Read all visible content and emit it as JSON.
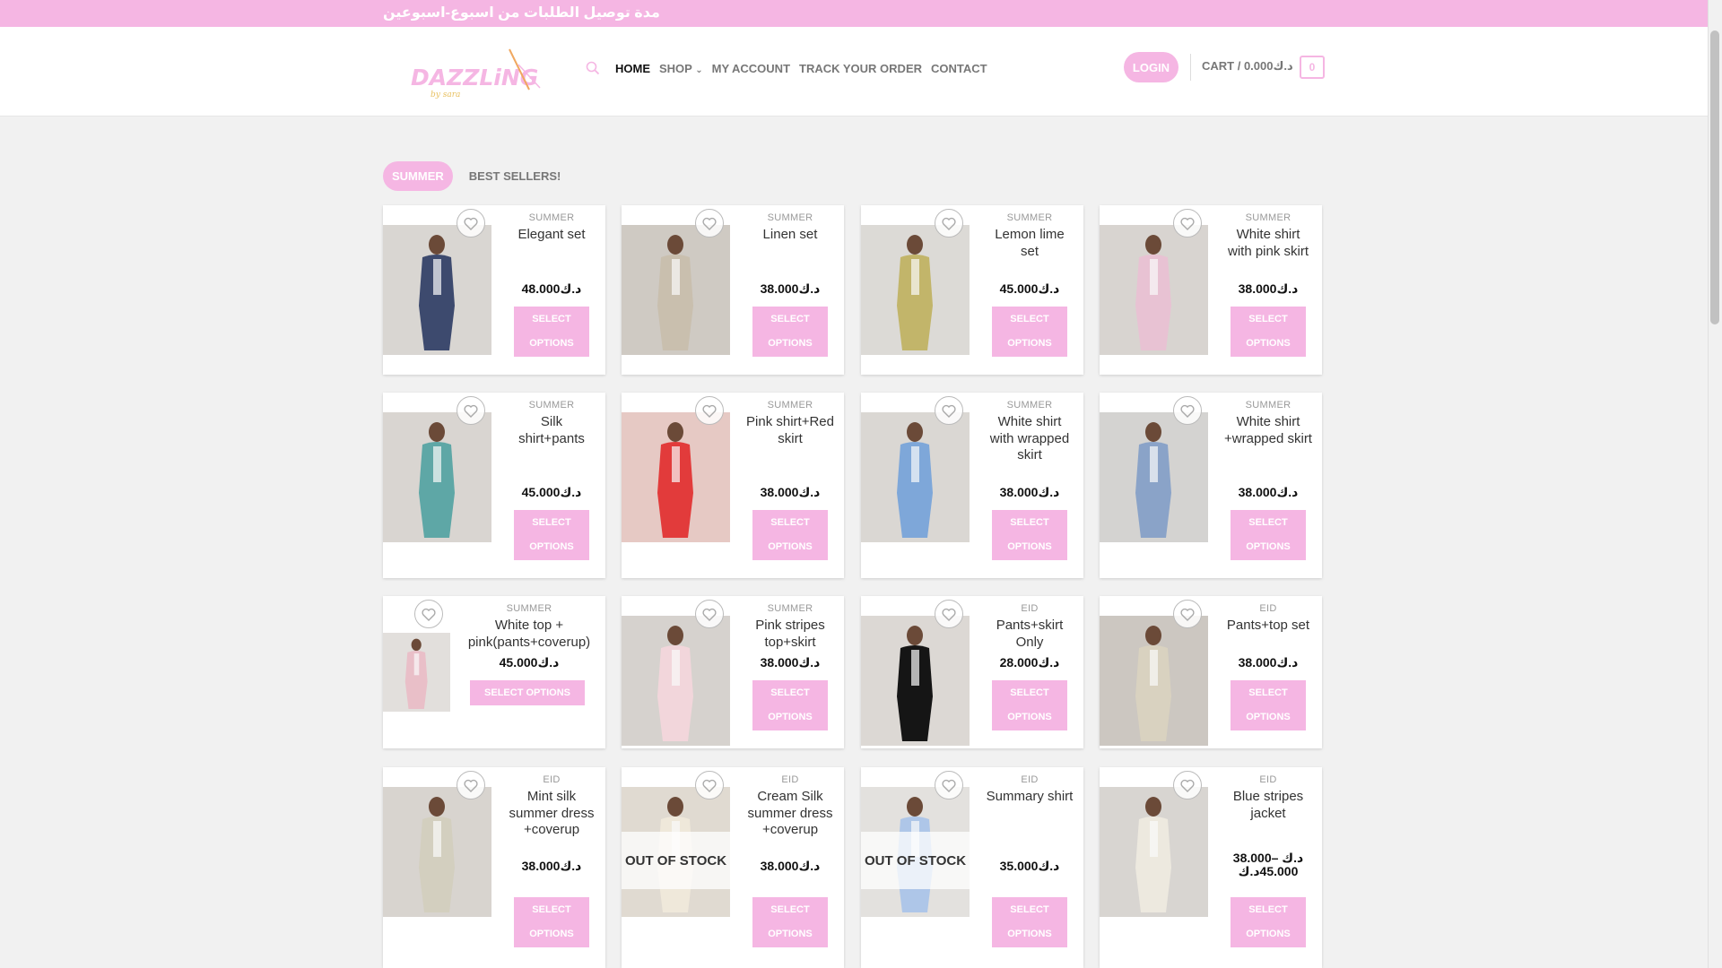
{
  "topbar": {
    "text": "مدة توصيل الطلبات من اسبوع-اسبوعين"
  },
  "header": {
    "logo_text": "DAZZLiNG",
    "logo_sub": "by sara",
    "nav": [
      {
        "label": "HOME",
        "active": true
      },
      {
        "label": "SHOP",
        "active": false
      },
      {
        "label": "MY ACCOUNT",
        "active": false
      },
      {
        "label": "TRACK YOUR ORDER",
        "active": false
      },
      {
        "label": "CONTACT",
        "active": false
      }
    ],
    "login_label": "LOGIN",
    "cart_label": "CART / 0.000د.ك",
    "cart_count": "0"
  },
  "tabs": [
    {
      "label": "SUMMER",
      "active": true
    },
    {
      "label": "BEST SELLERS!",
      "active": false
    }
  ],
  "products": [
    {
      "category": "SUMMER",
      "title": "Elegant set",
      "price": "48.000د.ك",
      "button": "SELECT OPTIONS",
      "out_of_stock": false
    },
    {
      "category": "SUMMER",
      "title": "Linen set",
      "price": "38.000د.ك",
      "button": "SELECT OPTIONS",
      "out_of_stock": false
    },
    {
      "category": "SUMMER",
      "title": "Lemon lime set",
      "price": "45.000د.ك",
      "button": "SELECT OPTIONS",
      "out_of_stock": false
    },
    {
      "category": "SUMMER",
      "title": "White shirt with pink skirt",
      "price": "38.000د.ك",
      "button": "SELECT OPTIONS",
      "out_of_stock": false
    },
    {
      "category": "SUMMER",
      "title": "Silk shirt+pants",
      "price": "45.000د.ك",
      "button": "SELECT OPTIONS",
      "out_of_stock": false
    },
    {
      "category": "SUMMER",
      "title": "Pink shirt+Red skirt",
      "price": "38.000د.ك",
      "button": "SELECT OPTIONS",
      "out_of_stock": false
    },
    {
      "category": "SUMMER",
      "title": "White shirt with wrapped skirt",
      "price": "38.000د.ك",
      "button": "SELECT OPTIONS",
      "out_of_stock": false
    },
    {
      "category": "SUMMER",
      "title": "White shirt +wrapped skirt",
      "price": "38.000د.ك",
      "button": "SELECT OPTIONS",
      "out_of_stock": false
    },
    {
      "category": "SUMMER",
      "title": "White top + pink(pants+coverup)",
      "price": "45.000د.ك",
      "button": "SELECT OPTIONS",
      "out_of_stock": false
    },
    {
      "category": "SUMMER",
      "title": "Pink stripes top+skirt",
      "price": "38.000د.ك",
      "button": "SELECT OPTIONS",
      "out_of_stock": false
    },
    {
      "category": "EID",
      "title": "Pants+skirt Only",
      "price": "28.000د.ك",
      "button": "SELECT OPTIONS",
      "out_of_stock": false
    },
    {
      "category": "EID",
      "title": "Pants+top set",
      "price": "38.000د.ك",
      "button": "SELECT OPTIONS",
      "out_of_stock": false
    },
    {
      "category": "EID",
      "title": "Mint silk summer dress +coverup",
      "price": "38.000د.ك",
      "button": "SELECT OPTIONS",
      "out_of_stock": false
    },
    {
      "category": "EID",
      "title": "Cream Silk summer dress +coverup",
      "price": "38.000د.ك",
      "button": "SELECT OPTIONS",
      "out_of_stock": true
    },
    {
      "category": "EID",
      "title": "Summary shirt",
      "price": "35.000د.ك",
      "button": "SELECT OPTIONS",
      "out_of_stock": true
    },
    {
      "category": "EID",
      "title": "Blue stripes jacket",
      "price": "38.000د.ك – 45.000د.ك",
      "button": "SELECT OPTIONS",
      "out_of_stock": false
    }
  ],
  "out_of_stock_label": "OUT OF STOCK",
  "colors": {
    "accent": "#f5b6e3"
  }
}
